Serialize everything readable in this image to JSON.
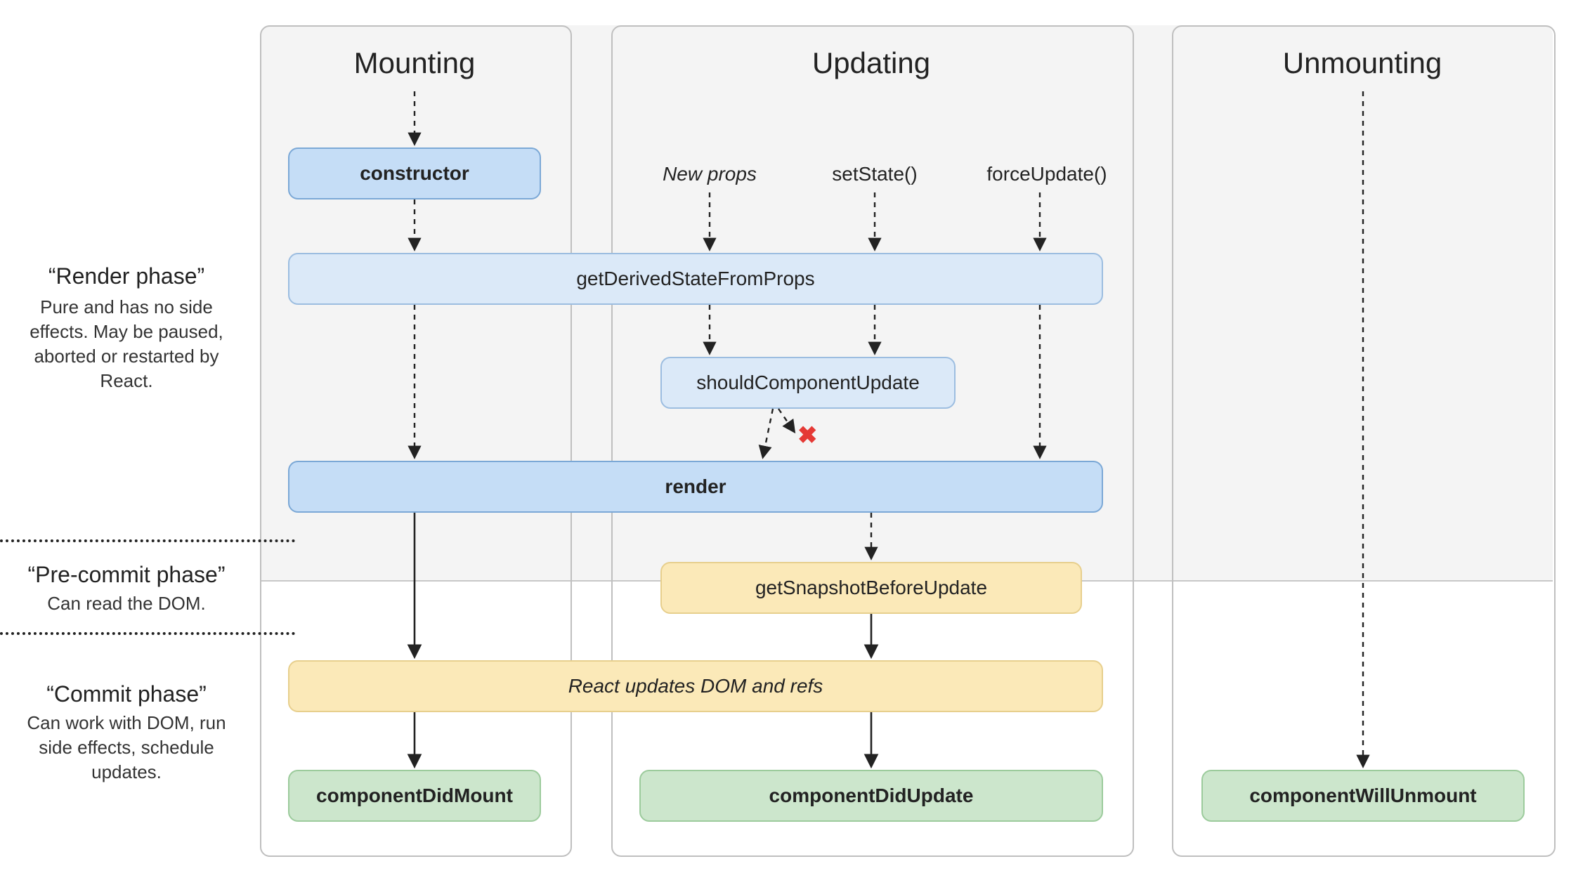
{
  "columns": {
    "mounting": "Mounting",
    "updating": "Updating",
    "unmounting": "Unmounting"
  },
  "phases": {
    "render": {
      "title": "“Render phase”",
      "desc": "Pure and has no side effects. May be paused, aborted or restarted by React."
    },
    "precommit": {
      "title": "“Pre-commit phase”",
      "desc": "Can read the DOM."
    },
    "commit": {
      "title": "“Commit phase”",
      "desc": "Can work with DOM, run side effects, schedule updates."
    }
  },
  "triggers": {
    "newProps": "New props",
    "setState": "setState()",
    "forceUpdate": "forceUpdate()"
  },
  "boxes": {
    "constructor": "constructor",
    "getDerivedStateFromProps": "getDerivedStateFromProps",
    "shouldComponentUpdate": "shouldComponentUpdate",
    "render": "render",
    "getSnapshotBeforeUpdate": "getSnapshotBeforeUpdate",
    "reactUpdatesDom": "React updates DOM and refs",
    "componentDidMount": "componentDidMount",
    "componentDidUpdate": "componentDidUpdate",
    "componentWillUnmount": "componentWillUnmount"
  },
  "crossMark": "✖"
}
